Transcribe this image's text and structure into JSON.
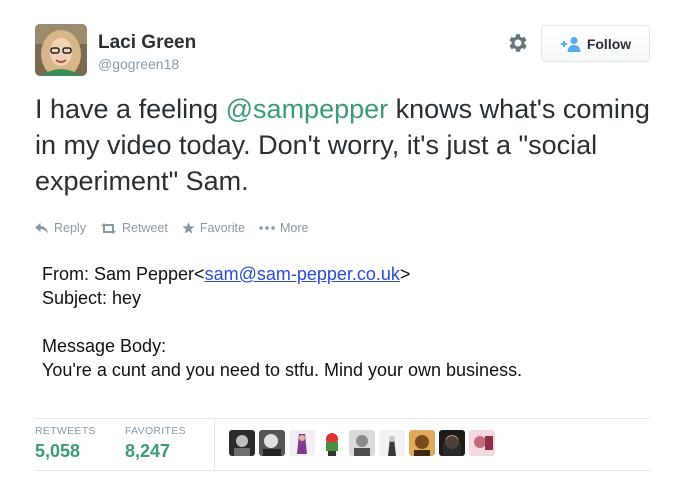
{
  "user": {
    "name": "Laci Green",
    "handle": "@gogreen18"
  },
  "header": {
    "follow_label": "Follow"
  },
  "tweet": {
    "text_before": "I have a feeling ",
    "mention": "@sampepper",
    "text_after": " knows what's coming in my video today. Don't worry, it's just a \"social experiment\" Sam."
  },
  "actions": {
    "reply": "Reply",
    "retweet": "Retweet",
    "favorite": "Favorite",
    "more": "More"
  },
  "email": {
    "from_label": "From: Sam Pepper<",
    "from_address": "sam@sam-pepper.co.uk",
    "from_close": ">",
    "subject": "Subject: hey",
    "body_label": "Message Body:",
    "body_text": "You're a cunt and you need to stfu.  Mind your own business."
  },
  "stats": {
    "retweets_label": "RETWEETS",
    "retweets_value": "5,058",
    "favorites_label": "FAVORITES",
    "favorites_value": "8,247"
  },
  "colors": {
    "accent": "#3b9b76",
    "muted": "#8899a6",
    "link": "#2a4cd8"
  }
}
